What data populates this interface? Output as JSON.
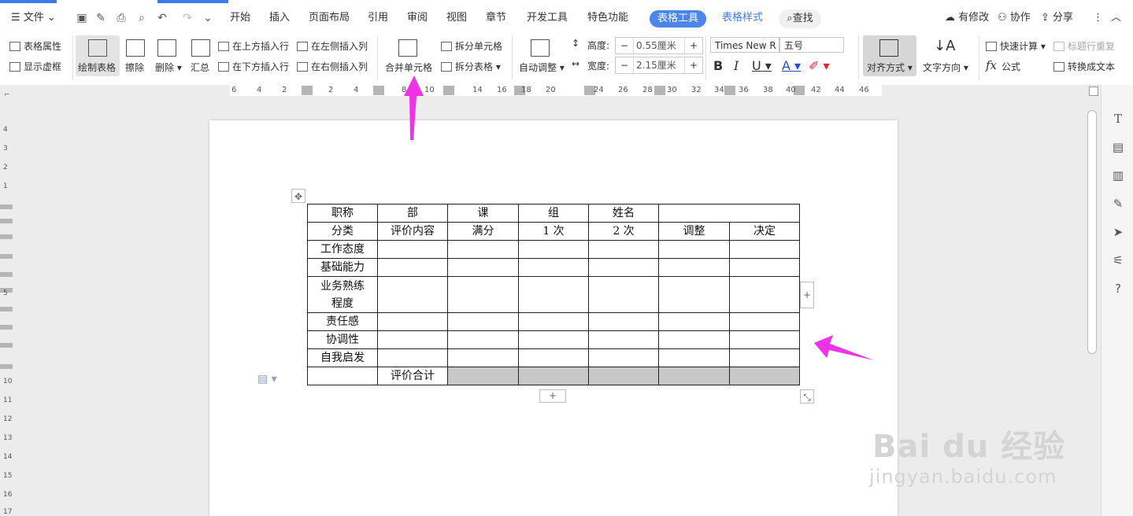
{
  "menubar": {
    "file": "文件",
    "tabs": [
      "开始",
      "插入",
      "页面布局",
      "引用",
      "审阅",
      "视图",
      "章节",
      "开发工具",
      "特色功能"
    ],
    "active_tab": "表格工具",
    "style_tab": "表格样式",
    "search": "查找",
    "right": {
      "modified": "有修改",
      "collab": "协作",
      "share": "分享"
    }
  },
  "toolbar": {
    "table_props": "表格属性",
    "show_grid": "显示虚框",
    "draw_table": "绘制表格",
    "erase": "擦除",
    "delete": "删除",
    "summary": "汇总",
    "insert_above": "在上方插入行",
    "insert_below": "在下方插入行",
    "insert_left": "在左侧插入列",
    "insert_right": "在右侧插入列",
    "merge_cells": "合并单元格",
    "split_cells": "拆分单元格",
    "split_table": "拆分表格",
    "auto_fit": "自动调整",
    "height_label": "高度:",
    "height_value": "0.55厘米",
    "width_label": "宽度:",
    "width_value": "2.15厘米",
    "font_name": "Times New R",
    "font_size": "五号",
    "align": "对齐方式",
    "text_dir": "文字方向",
    "quick_calc": "快速计算",
    "repeat_header": "标题行重复",
    "formula": "公式",
    "to_text": "转换成文本"
  },
  "ruler": {
    "h": [
      "6",
      "4",
      "2",
      "2",
      "4",
      "8",
      "10",
      "14",
      "16",
      "18",
      "20",
      "24",
      "26",
      "28",
      "30",
      "32",
      "34",
      "36",
      "38",
      "40",
      "42",
      "44",
      "46"
    ],
    "v": [
      "4",
      "3",
      "2",
      "1",
      "5",
      "10",
      "11",
      "12",
      "13",
      "14",
      "15",
      "16",
      "17"
    ]
  },
  "table": {
    "rows": [
      [
        "职称",
        "部",
        "课",
        "组",
        "姓名",
        "",
        ""
      ],
      [
        "分类",
        "评价内容",
        "满分",
        "1 次",
        "2 次",
        "调整",
        "决定"
      ],
      [
        "工作态度",
        "",
        "",
        "",
        "",
        "",
        ""
      ],
      [
        "基础能力",
        "",
        "",
        "",
        "",
        "",
        ""
      ],
      [
        "业务熟练程度",
        "",
        "",
        "",
        "",
        "",
        ""
      ],
      [
        "责任感",
        "",
        "",
        "",
        "",
        "",
        ""
      ],
      [
        "协调性",
        "",
        "",
        "",
        "",
        "",
        ""
      ],
      [
        "自我启发",
        "",
        "",
        "",
        "",
        "",
        ""
      ],
      [
        "",
        "评价合计",
        "",
        "",
        "",
        "",
        ""
      ]
    ]
  },
  "watermark": {
    "main": "Bai du 经验",
    "sub": "jingyan.baidu.com"
  },
  "colors": {
    "accent": "#3b7be8",
    "arrow": "#ee32e6",
    "gray_cell": "#c8c8c8"
  }
}
